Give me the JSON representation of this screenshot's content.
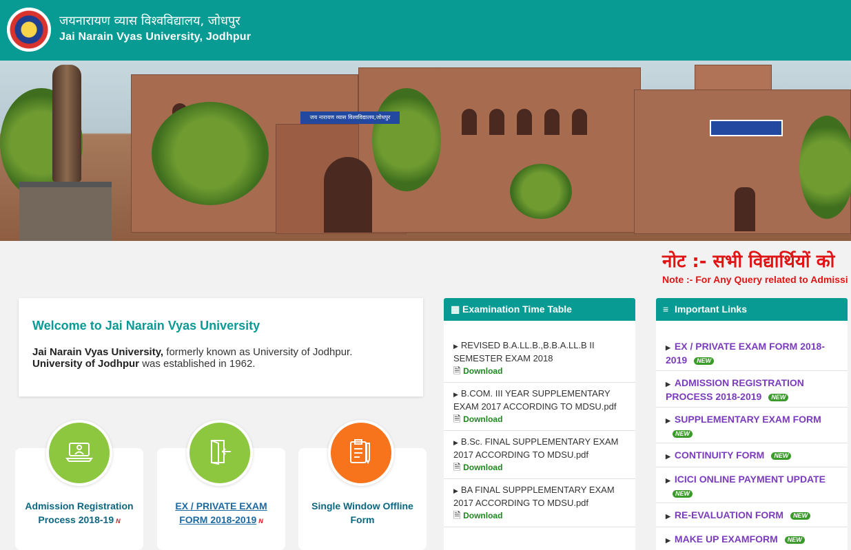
{
  "header": {
    "title_hi": "जयनारायण व्यास विश्वविद्यालय, जोधपुर",
    "title_en": "Jai Narain Vyas University, Jodhpur",
    "banner_sign": "जय नारायण व्यास विश्वविद्यालय,जोधपुर"
  },
  "notice": {
    "hindi": "नोट :- सभी विद्यार्थियों को",
    "english": "Note :- For Any Query related to Admissi"
  },
  "welcome": {
    "heading": "Welcome to Jai Narain Vyas University",
    "bold1": "Jai Narain Vyas University,",
    "text1": " formerly known as University of Jodhpur.",
    "bold2": "University of Jodhpur",
    "text2": " was established in 1962."
  },
  "cards": [
    {
      "line1": "Admission Registration",
      "line2": "Process 2018-19",
      "new_mark": "N",
      "color": "#8dc63f"
    },
    {
      "line1": "EX / PRIVATE EXAM",
      "line2": "FORM 2018-2019",
      "new_mark": "N",
      "color": "#8dc63f"
    },
    {
      "line1": "Single Window Offline",
      "line2": "Form",
      "color": "#f7731c"
    }
  ],
  "exam_panel": {
    "title": "Examination Time Table",
    "download_label": "Download",
    "items": [
      {
        "l1": "REVISED B.A.LL.B.,B.B.A.LL.B II",
        "l2": "SEMESTER EXAM 2018"
      },
      {
        "l1": "B.COM. III YEAR SUPPLEMENTARY",
        "l2": "EXAM 2017 ACCORDING TO MDSU.pdf"
      },
      {
        "l1": "B.Sc. FINAL SUPPLEMENTARY EXAM",
        "l2": "2017 ACCORDING TO MDSU.pdf"
      },
      {
        "l1": "BA FINAL SUPPPLEMENTARY EXAM",
        "l2": "2017 ACCORDING TO MDSU.pdf"
      }
    ]
  },
  "links_panel": {
    "title": "Important Links",
    "new_label": "NEW",
    "items": [
      {
        "l1": "EX / PRIVATE EXAM FORM 2018-",
        "l2": "2019"
      },
      {
        "l1": "ADMISSION REGISTRATION",
        "l2": "PROCESS 2018-2019"
      },
      {
        "l1": "SUPPLEMENTARY EXAM FORM",
        "l2": ""
      },
      {
        "l1": "CONTINUITY FORM",
        "l2": null
      },
      {
        "l1": "ICICI ONLINE PAYMENT UPDATE",
        "l2": ""
      },
      {
        "l1": "RE-EVALUATION FORM",
        "l2": null
      },
      {
        "l1": "MAKE UP EXAMFORM",
        "l2": null
      }
    ]
  },
  "colors": {
    "brand": "#079b94",
    "notice": "#e01414",
    "link": "#7a3bbd"
  }
}
